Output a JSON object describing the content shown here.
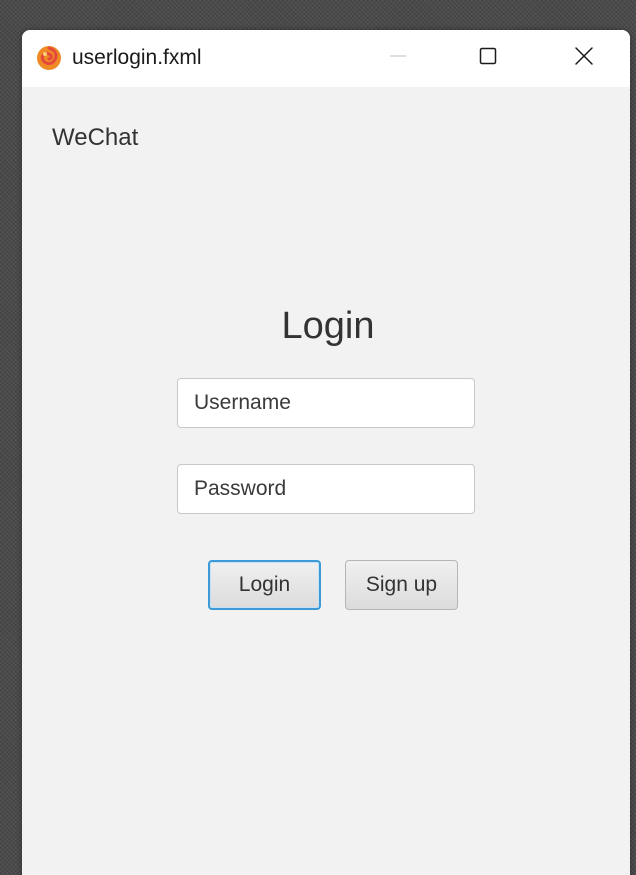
{
  "window": {
    "title": "userlogin.fxml",
    "icon": "app-logo-icon",
    "controls": {
      "minimize_icon": "minimize-icon",
      "maximize_icon": "maximize-icon",
      "close_icon": "close-icon"
    }
  },
  "app": {
    "brand": "WeChat"
  },
  "form": {
    "heading": "Login",
    "username_placeholder": "Username",
    "username_value": "",
    "password_placeholder": "Password",
    "password_value": "",
    "login_label": "Login",
    "signup_label": "Sign up"
  },
  "colors": {
    "background": "#f2f2f2",
    "titlebar": "#ffffff",
    "focus_accent": "#3d9ad6",
    "icon_orange": "#f08a24",
    "icon_red": "#e24a3b"
  }
}
